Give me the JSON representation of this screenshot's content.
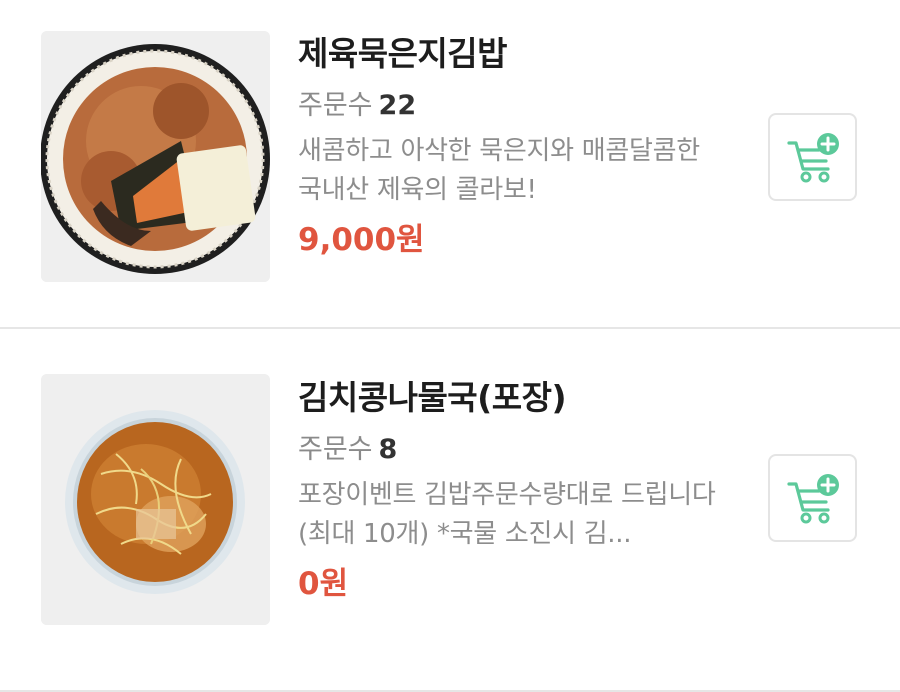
{
  "items": [
    {
      "name": "제육묵은지김밥",
      "orders_label": "주문수",
      "orders_count": "22",
      "description": "새콤하고 아삭한 묵은지와 매콤달콤한 국내산 제육의 콜라보!",
      "price": "9,000원",
      "image_icon": "kimbap-roll-photo"
    },
    {
      "name": "김치콩나물국(포장)",
      "orders_label": "주문수",
      "orders_count": "8",
      "description": "포장이벤트 김밥주문수량대로 드립니다(최대 10개) *국물 소진시 김...",
      "price": "0원",
      "image_icon": "kimchi-bean-sprout-soup-photo"
    }
  ],
  "colors": {
    "price": "#e0553f",
    "cart_icon": "#5cc99a",
    "divider": "#e6e6e6"
  },
  "add_to_cart_icon": "cart-plus-icon"
}
